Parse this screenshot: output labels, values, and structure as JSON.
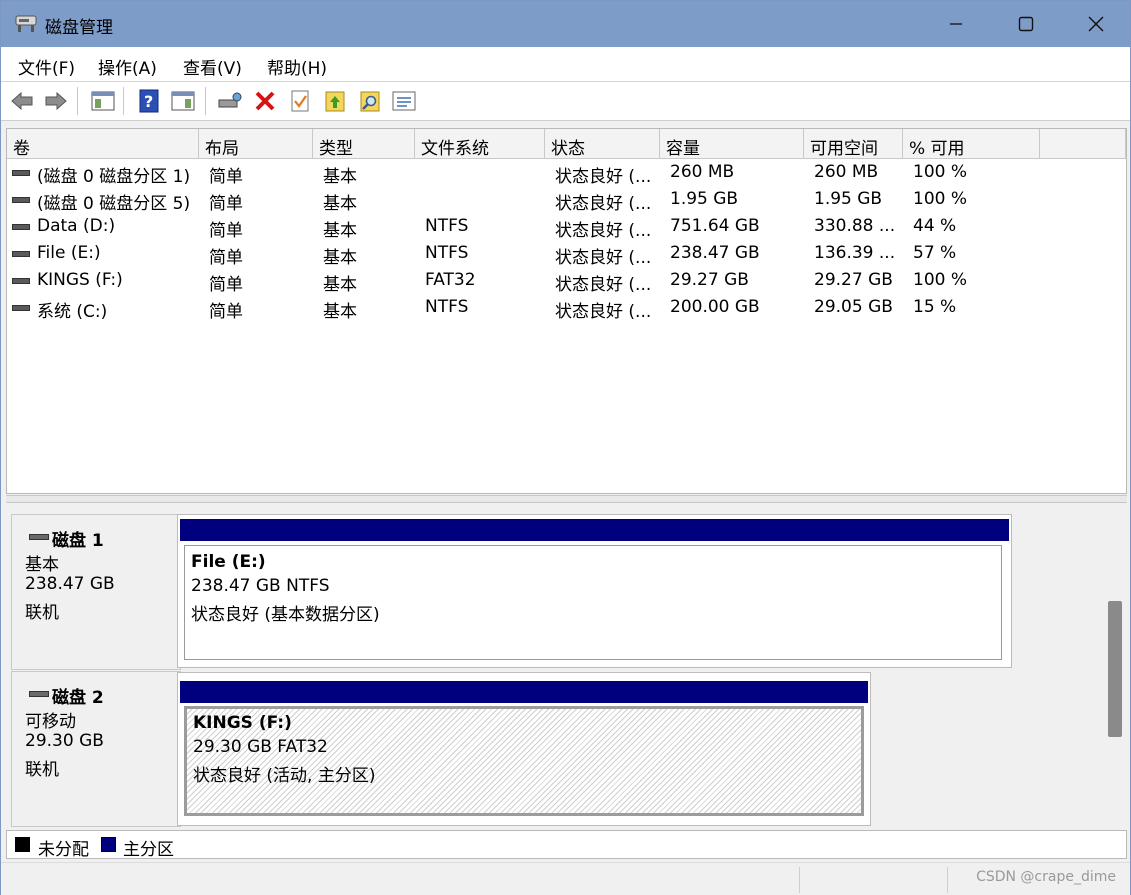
{
  "window": {
    "title": "磁盘管理",
    "app_icon": "disk-management-icon"
  },
  "menu": [
    "文件(F)",
    "操作(A)",
    "查看(V)",
    "帮助(H)"
  ],
  "toolbar": [
    "back-icon",
    "forward-icon",
    "show-hide-console-tree-icon",
    "help-icon",
    "show-hide-action-pane-icon",
    "connect-drive-icon",
    "delete-icon",
    "check-icon",
    "export-list-icon",
    "search-icon",
    "properties-icon"
  ],
  "volumes": {
    "headers": [
      "卷",
      "布局",
      "类型",
      "文件系统",
      "状态",
      "容量",
      "可用空间",
      "% 可用"
    ],
    "rows": [
      [
        "(磁盘 0 磁盘分区 1)",
        "简单",
        "基本",
        "",
        "状态良好 (...",
        "260 MB",
        "260 MB",
        "100 %"
      ],
      [
        "(磁盘 0 磁盘分区 5)",
        "简单",
        "基本",
        "",
        "状态良好 (...",
        "1.95 GB",
        "1.95 GB",
        "100 %"
      ],
      [
        "Data (D:)",
        "简单",
        "基本",
        "NTFS",
        "状态良好 (...",
        "751.64 GB",
        "330.88 ...",
        "44 %"
      ],
      [
        "File (E:)",
        "简单",
        "基本",
        "NTFS",
        "状态良好 (...",
        "238.47 GB",
        "136.39 ...",
        "57 %"
      ],
      [
        "KINGS (F:)",
        "简单",
        "基本",
        "FAT32",
        "状态良好 (...",
        "29.27 GB",
        "29.27 GB",
        "100 %"
      ],
      [
        "系统 (C:)",
        "简单",
        "基本",
        "NTFS",
        "状态良好 (...",
        "200.00 GB",
        "29.05 GB",
        "15 %"
      ]
    ]
  },
  "disks": [
    {
      "name": "磁盘 1",
      "type": "基本",
      "size": "238.47 GB",
      "status": "联机",
      "partition": {
        "name": "File  (E:)",
        "size_fs": "238.47 GB NTFS",
        "status": "状态良好 (基本数据分区)"
      }
    },
    {
      "name": "磁盘 2",
      "type": "可移动",
      "size": "29.30 GB",
      "status": "联机",
      "partition": {
        "name": "KINGS  (F:)",
        "size_fs": "29.30 GB FAT32",
        "status": "状态良好 (活动, 主分区)"
      }
    }
  ],
  "legend": [
    {
      "label": "未分配",
      "color": "#000000"
    },
    {
      "label": "主分区",
      "color": "#00007e"
    }
  ],
  "watermark": "CSDN @crape_dime"
}
